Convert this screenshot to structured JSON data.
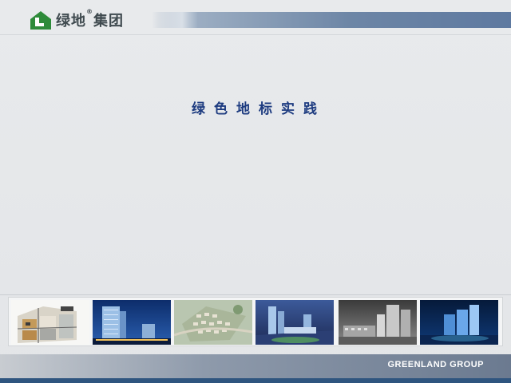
{
  "header": {
    "logo_text": "绿地",
    "logo_reg": "®",
    "logo_text_2": "集团",
    "logo_icon": "greenland-house-logo-icon"
  },
  "slide": {
    "title": "绿色地标实践"
  },
  "photos": [
    {
      "name": "house-cutaway-render"
    },
    {
      "name": "night-tower-render"
    },
    {
      "name": "aerial-masterplan-render"
    },
    {
      "name": "commercial-complex-night-render"
    },
    {
      "name": "street-view-render"
    },
    {
      "name": "blue-towers-night-render"
    }
  ],
  "footer": {
    "company": "GREENLAND GROUP"
  },
  "colors": {
    "title": "#1d3b80",
    "brand_green": "#2e8b3a",
    "footer_dark": "#2f557f"
  }
}
